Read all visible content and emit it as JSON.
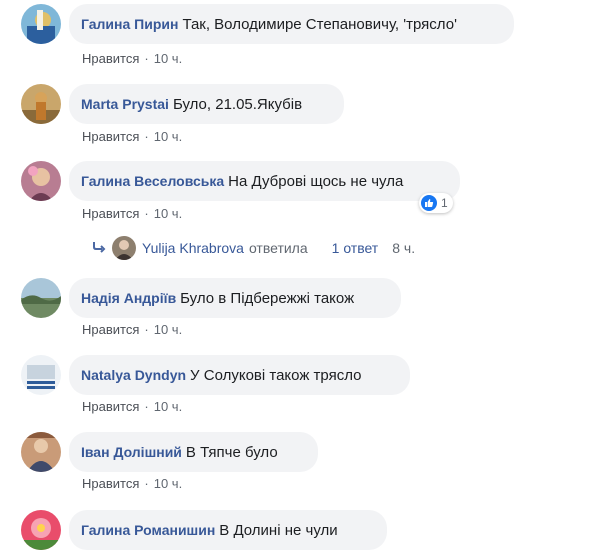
{
  "comments": [
    {
      "author": "Галина Пирин",
      "text": "Так, Володимире Степановичу, 'трясло'",
      "like": "Нравится",
      "time": "10 ч."
    },
    {
      "author": "Marta Prystai",
      "text": "Було, 21.05.Якубів",
      "like": "Нравится",
      "time": "10 ч."
    },
    {
      "author": "Галина Веселовська",
      "text": "На Дуброві щось не чула",
      "like": "Нравится",
      "time": "10 ч.",
      "reaction_count": "1"
    },
    {
      "author": "Надія Андріїв",
      "text": "Було в Підбережжі також",
      "like": "Нравится",
      "time": "10 ч."
    },
    {
      "author": "Natalya Dyndyn",
      "text": "У Солукові також трясло",
      "like": "Нравится",
      "time": "10 ч."
    },
    {
      "author": "Іван Долішний",
      "text": "В Тяпче було",
      "like": "Нравится",
      "time": "10 ч."
    },
    {
      "author": "Галина Романишин",
      "text": "В Долині не чули"
    }
  ],
  "reply": {
    "name": "Yulija Khrabrova",
    "action": "ответила",
    "count": "1 ответ",
    "time": "8 ч."
  },
  "meta_separator": "·",
  "colors": {
    "name_link": "#385898",
    "bubble": "#f2f3f5",
    "like_blue": "#1877f2"
  }
}
